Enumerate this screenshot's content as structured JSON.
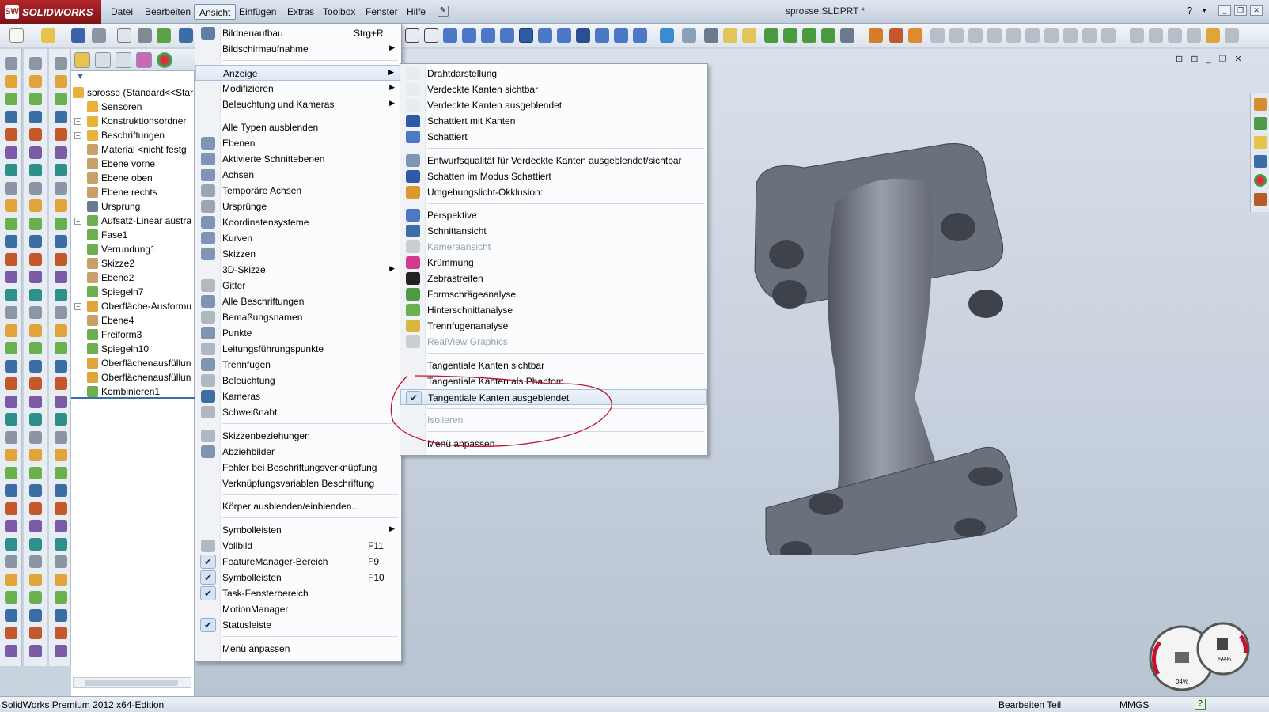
{
  "app": {
    "logo_text": "SOLIDWORKS",
    "document_title": "sprosse.SLDPRT *"
  },
  "menubar": {
    "items": [
      "Datei",
      "Bearbeiten",
      "Ansicht",
      "Einfügen",
      "Extras",
      "Toolbox",
      "Fenster",
      "Hilfe"
    ],
    "active": "Ansicht"
  },
  "feature_tree": {
    "root": "sprosse  (Standard<<Star",
    "items": [
      "Sensoren",
      "Konstruktionsordner",
      "Beschriftungen",
      "Material <nicht festg",
      "Ebene vorne",
      "Ebene oben",
      "Ebene rechts",
      "Ursprung",
      "Aufsatz-Linear austra",
      "Fase1",
      "Verrundung1",
      "Skizze2",
      "Ebene2",
      "Spiegeln7",
      "Oberfläche-Ausformu",
      "Ebene4",
      "Freiform3",
      "Spiegeln10",
      "Oberflächenausfüllun",
      "Oberflächenausfüllun",
      "Kombinieren1"
    ]
  },
  "view_menu": {
    "items": [
      {
        "label": "Bildneuaufbau",
        "shortcut": "Strg+R"
      },
      {
        "label": "Bildschirmaufnahme",
        "submenu": true
      },
      {
        "label": "Anzeige",
        "submenu": true,
        "highlighted": true
      },
      {
        "label": "Modifizieren",
        "submenu": true
      },
      {
        "label": "Beleuchtung und Kameras",
        "submenu": true
      },
      {
        "label": "Alle Typen ausblenden"
      },
      {
        "label": "Ebenen"
      },
      {
        "label": "Aktivierte Schnittebenen"
      },
      {
        "label": "Achsen"
      },
      {
        "label": "Temporäre Achsen"
      },
      {
        "label": "Ursprünge"
      },
      {
        "label": "Koordinatensysteme"
      },
      {
        "label": "Kurven"
      },
      {
        "label": "Skizzen"
      },
      {
        "label": "3D-Skizze",
        "submenu": true
      },
      {
        "label": "Gitter"
      },
      {
        "label": "Alle Beschriftungen"
      },
      {
        "label": "Bemaßungsnamen"
      },
      {
        "label": "Punkte"
      },
      {
        "label": "Leitungsführungspunkte"
      },
      {
        "label": "Trennfugen"
      },
      {
        "label": "Beleuchtung"
      },
      {
        "label": "Kameras"
      },
      {
        "label": "Schweißnaht"
      },
      {
        "label": "Skizzenbeziehungen"
      },
      {
        "label": "Abziehbilder"
      },
      {
        "label": "Fehler bei Beschriftungsverknüpfung"
      },
      {
        "label": "Verknüpfungsvariablen Beschriftung"
      },
      {
        "label": "Körper ausblenden/einblenden..."
      },
      {
        "label": "Symbolleisten",
        "submenu": true
      },
      {
        "label": "Vollbild",
        "shortcut": "F11"
      },
      {
        "label": "FeatureManager-Bereich",
        "shortcut": "F9",
        "checked": true
      },
      {
        "label": "Symbolleisten",
        "shortcut": "F10",
        "checked": true
      },
      {
        "label": "Task-Fensterbereich",
        "checked": true
      },
      {
        "label": "MotionManager"
      },
      {
        "label": "Statusleiste",
        "checked": true
      },
      {
        "label": "Menü anpassen"
      }
    ]
  },
  "display_submenu": {
    "items": [
      {
        "label": "Drahtdarstellung"
      },
      {
        "label": "Verdeckte Kanten sichtbar"
      },
      {
        "label": "Verdeckte Kanten ausgeblendet"
      },
      {
        "label": "Schattiert mit Kanten"
      },
      {
        "label": "Schattiert"
      },
      {
        "label": "Entwurfsqualität für Verdeckte Kanten ausgeblendet/sichtbar"
      },
      {
        "label": "Schatten im Modus Schattiert"
      },
      {
        "label": "Umgebungslicht-Okklusion:"
      },
      {
        "label": "Perspektive"
      },
      {
        "label": "Schnittansicht"
      },
      {
        "label": "Kameraansicht",
        "disabled": true
      },
      {
        "label": "Krümmung"
      },
      {
        "label": "Zebrastreifen"
      },
      {
        "label": "Formschrägeanalyse"
      },
      {
        "label": "Hinterschnittanalyse"
      },
      {
        "label": "Trennfugenanalyse"
      },
      {
        "label": "RealView Graphics",
        "disabled": true
      },
      {
        "label": "Tangentiale Kanten sichtbar"
      },
      {
        "label": "Tangentiale Kanten als Phantom"
      },
      {
        "label": "Tangentiale Kanten ausgeblendet",
        "checked": true
      },
      {
        "label": "Isolieren",
        "disabled": true
      },
      {
        "label": "Menü anpassen"
      }
    ]
  },
  "statusbar": {
    "left": "SolidWorks Premium 2012 x64-Edition",
    "mode": "Bearbeiten Teil",
    "units": "MMGS",
    "help": "?"
  },
  "gauges": {
    "cpu": "04%",
    "memory": "59%"
  },
  "colors": {
    "accent": "#3a6ea5",
    "annotation": "#c8102e",
    "part": "#6e7480"
  }
}
